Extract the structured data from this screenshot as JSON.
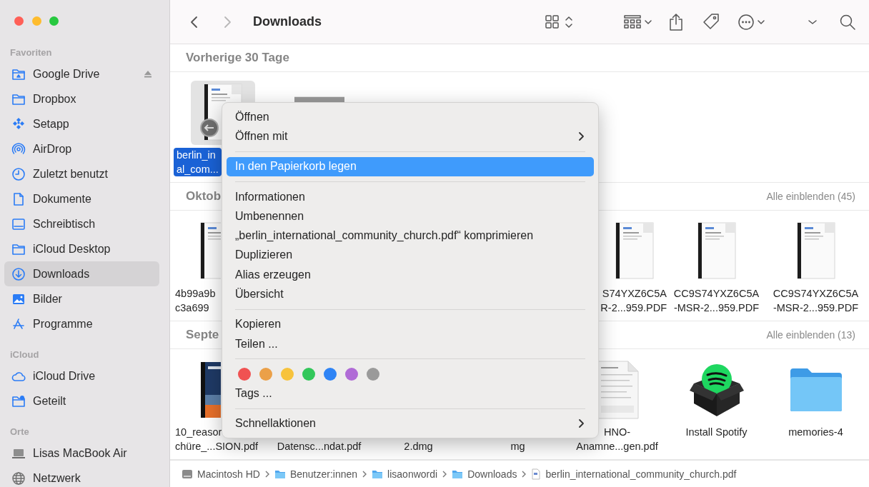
{
  "window": {
    "traffic_lights": [
      {
        "color": "#ff5f57"
      },
      {
        "color": "#febc2e"
      },
      {
        "color": "#28c840"
      }
    ]
  },
  "sidebar": {
    "sections": [
      {
        "heading": "Favoriten",
        "items": [
          {
            "label": "Google Drive",
            "kind": "drive",
            "selected": false,
            "eject": true
          },
          {
            "label": "Dropbox",
            "kind": "folder",
            "selected": false,
            "eject": false
          },
          {
            "label": "Setapp",
            "kind": "setapp",
            "selected": false,
            "eject": false
          },
          {
            "label": "AirDrop",
            "kind": "airdrop",
            "selected": false,
            "eject": false
          },
          {
            "label": "Zuletzt benutzt",
            "kind": "clock",
            "selected": false,
            "eject": false
          },
          {
            "label": "Dokumente",
            "kind": "document",
            "selected": false,
            "eject": false
          },
          {
            "label": "Schreibtisch",
            "kind": "desktop",
            "selected": false,
            "eject": false
          },
          {
            "label": "iCloud Desktop",
            "kind": "folder",
            "selected": false,
            "eject": false
          },
          {
            "label": "Downloads",
            "kind": "download",
            "selected": true,
            "eject": false
          },
          {
            "label": "Bilder",
            "kind": "photo",
            "selected": false,
            "eject": false
          },
          {
            "label": "Programme",
            "kind": "apps",
            "selected": false,
            "eject": false
          }
        ]
      },
      {
        "heading": "iCloud",
        "items": [
          {
            "label": "iCloud Drive",
            "kind": "cloud",
            "selected": false,
            "eject": false
          },
          {
            "label": "Geteilt",
            "kind": "shared",
            "selected": false,
            "eject": false
          }
        ]
      },
      {
        "heading": "Orte",
        "items": [
          {
            "label": "Lisas MacBook Air",
            "kind": "laptop",
            "selected": false,
            "eject": false
          },
          {
            "label": "Netzwerk",
            "kind": "globe",
            "selected": false,
            "eject": false
          }
        ]
      }
    ]
  },
  "toolbar": {
    "back": {
      "disabled": false
    },
    "forward": {
      "disabled": true
    },
    "title": "Downloads"
  },
  "content": {
    "sections": [
      {
        "heading": "Vorherige 30 Tage",
        "items": [
          {
            "kind": "pdf",
            "label_lines": [
              "berlin_in",
              "al_com..."
            ],
            "cut_right": true,
            "cut_left": false,
            "selected": true
          },
          {
            "kind": "image"
          }
        ]
      },
      {
        "heading": "Oktob",
        "show_all": "Alle einblenden (45)",
        "items": [
          {
            "kind": "pdf",
            "label_lines": [
              "4b99a9b",
              "c3a699"
            ],
            "cut_right": true,
            "cut_left": false,
            "selected": false
          },
          {
            "kind": "covered"
          },
          {
            "kind": "covered"
          },
          {
            "kind": "covered"
          },
          {
            "kind": "pdf",
            "label_lines": [
              "S74YXZ6C5A",
              "R-2...959.PDF"
            ],
            "cut_right": false,
            "cut_left": true,
            "selected": false
          },
          {
            "kind": "pdf",
            "label_lines": [
              "CC9S74YXZ6C5A",
              "-MSR-2...959.PDF"
            ],
            "cut_right": false,
            "cut_left": false,
            "selected": false
          },
          {
            "kind": "pdf",
            "label_lines": [
              "CC9S74YXZ6C5A",
              "-MSR-2...959.PDF"
            ],
            "cut_right": false,
            "cut_left": false,
            "selected": false
          }
        ]
      },
      {
        "heading": "Septe",
        "show_all": "Alle einblenden (13)",
        "items": [
          {
            "kind": "book",
            "label_lines": [
              "10_reasor",
              "chüre_...SION.pdf"
            ],
            "cut_right": true,
            "cut_left": false,
            "selected": false
          },
          {
            "kind": "covered",
            "label_lines": [
              "Datensc...ndat.pdf"
            ],
            "cut_right": false,
            "cut_left": false,
            "selected": false
          },
          {
            "kind": "covered",
            "label_lines": [
              "2.dmg"
            ],
            "cut_right": false,
            "cut_left": false,
            "selected": false
          },
          {
            "kind": "covered",
            "label_lines": [
              "mg"
            ],
            "cut_right": false,
            "cut_left": false,
            "selected": false
          },
          {
            "kind": "document",
            "label_lines": [
              "HNO-",
              "Anamne...gen.pdf"
            ],
            "cut_right": false,
            "cut_left": false,
            "selected": false
          },
          {
            "kind": "package",
            "label_lines": [
              "Install Spotify"
            ],
            "cut_right": false,
            "cut_left": false,
            "selected": false
          },
          {
            "kind": "folder",
            "label_lines": [
              "memories-4"
            ],
            "cut_right": false,
            "cut_left": false,
            "selected": false
          }
        ]
      }
    ]
  },
  "context_menu": {
    "items": [
      {
        "kind": "item",
        "label": "Öffnen",
        "submenu": false,
        "selected": false
      },
      {
        "kind": "item",
        "label": "Öffnen mit",
        "submenu": true,
        "selected": false
      },
      {
        "kind": "separator"
      },
      {
        "kind": "item",
        "label": "In den Papierkorb legen",
        "submenu": false,
        "selected": true
      },
      {
        "kind": "separator"
      },
      {
        "kind": "item",
        "label": "Informationen",
        "submenu": false,
        "selected": false
      },
      {
        "kind": "item",
        "label": "Umbenennen",
        "submenu": false,
        "selected": false
      },
      {
        "kind": "item",
        "label": "„berlin_international_community_church.pdf“ komprimieren",
        "submenu": false,
        "selected": false
      },
      {
        "kind": "item",
        "label": "Duplizieren",
        "submenu": false,
        "selected": false
      },
      {
        "kind": "item",
        "label": "Alias erzeugen",
        "submenu": false,
        "selected": false
      },
      {
        "kind": "item",
        "label": "Übersicht",
        "submenu": false,
        "selected": false
      },
      {
        "kind": "separator"
      },
      {
        "kind": "item",
        "label": "Kopieren",
        "submenu": false,
        "selected": false
      },
      {
        "kind": "item",
        "label": "Teilen ...",
        "submenu": false,
        "selected": false
      },
      {
        "kind": "separator"
      },
      {
        "kind": "tags",
        "colors": [
          {
            "color": "#f05252"
          },
          {
            "color": "#eba048"
          },
          {
            "color": "#f7c33c"
          },
          {
            "color": "#32c75a"
          },
          {
            "color": "#2f84f5"
          },
          {
            "color": "#b06bd6"
          },
          {
            "color": "#9a9a9a"
          }
        ]
      },
      {
        "kind": "item",
        "label": "Tags ...",
        "submenu": false,
        "selected": false
      },
      {
        "kind": "separator"
      },
      {
        "kind": "item",
        "label": "Schnellaktionen",
        "submenu": true,
        "selected": false
      }
    ]
  },
  "path_bar": {
    "items": [
      {
        "kind": "disk",
        "label": "Macintosh HD"
      },
      {
        "kind": "folder",
        "label": "Benutzer:innen"
      },
      {
        "kind": "folder",
        "label": "lisaonwordi"
      },
      {
        "kind": "folder",
        "label": "Downloads"
      },
      {
        "kind": "file",
        "label": "berlin_international_community_church.pdf"
      }
    ]
  }
}
